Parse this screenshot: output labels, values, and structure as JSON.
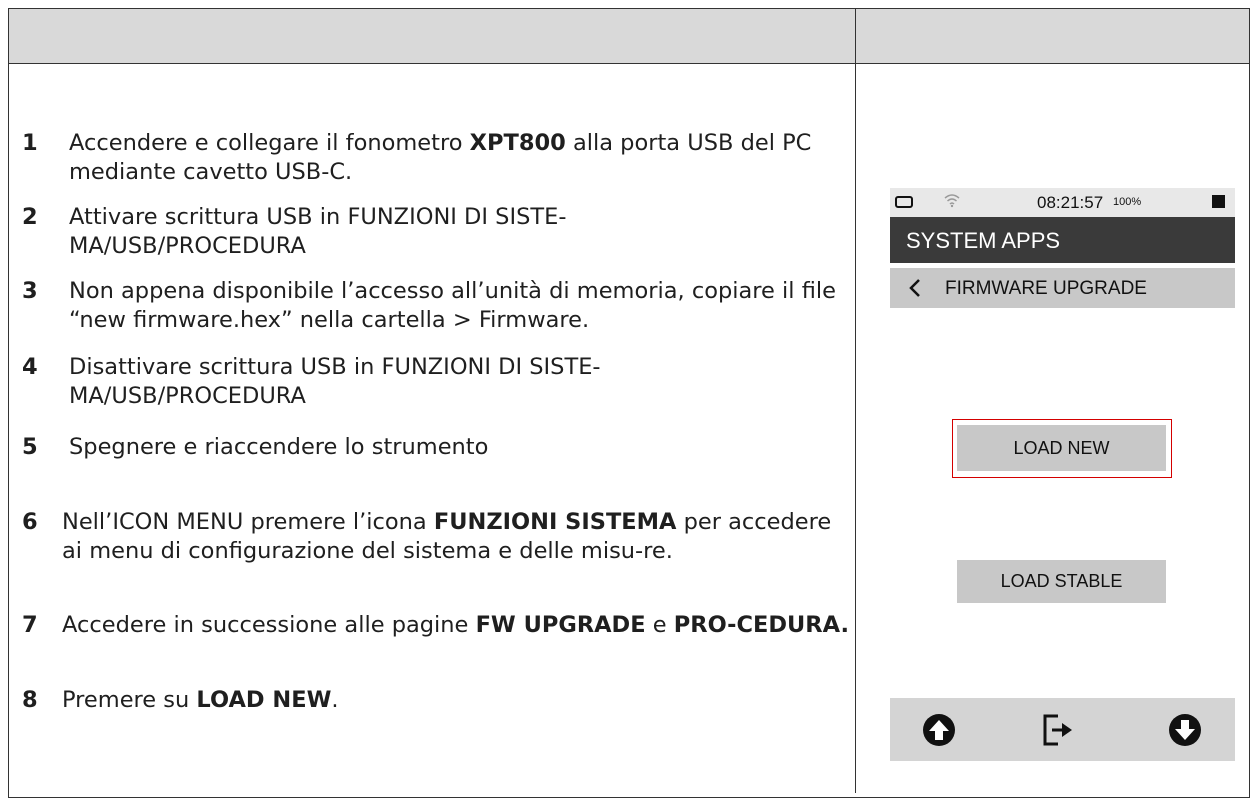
{
  "steps": [
    {
      "num": "1",
      "t1": "Accendere e collegare il fonometro ",
      "b1": "XPT800",
      "t2": " alla porta USB del PC mediante cavetto USB-C."
    },
    {
      "num": "2",
      "t1": "Attivare scrittura USB in FUNZIONI DI SISTE-MA/USB/PROCEDURA"
    },
    {
      "num": "3",
      "t1": "Non appena disponibile l’accesso all’unità di memoria, copiare il file “new firmware.hex” nella cartella > Firmware."
    },
    {
      "num": "4",
      "t1": "Disattivare scrittura USB in FUNZIONI DI SISTE-MA/USB/PROCEDURA"
    },
    {
      "num": "5",
      "t1": "Spegnere e riaccendere lo strumento"
    },
    {
      "num": "6",
      "t1": "Nell’ICON MENU premere l’icona ",
      "b1": "FUNZIONI SISTEMA",
      "t2": " per accedere ai menu di configurazione del sistema e delle misu-re."
    },
    {
      "num": "7",
      "t1": "Accedere in successione alle pagine ",
      "b1": "FW UPGRADE",
      "t2": " e ",
      "b2": "PRO-CEDURA."
    },
    {
      "num": "8",
      "t1": "Premere su ",
      "b1": "LOAD NEW",
      "t2": "."
    }
  ],
  "device": {
    "status": {
      "clock": "08:21:57",
      "battery_pct": "100%",
      "icons": [
        "battery-icon",
        "wifi-icon",
        "stop-icon"
      ]
    },
    "app_title": "SYSTEM APPS",
    "sub_title": "FIRMWARE UPGRADE",
    "back_icon": "chevron-left-icon",
    "load_new": "LOAD NEW",
    "load_stable": "LOAD STABLE",
    "nav_icons": [
      "arrow-up-circle-icon",
      "exit-icon",
      "arrow-down-circle-icon"
    ],
    "highlight_color": "#d40000"
  }
}
